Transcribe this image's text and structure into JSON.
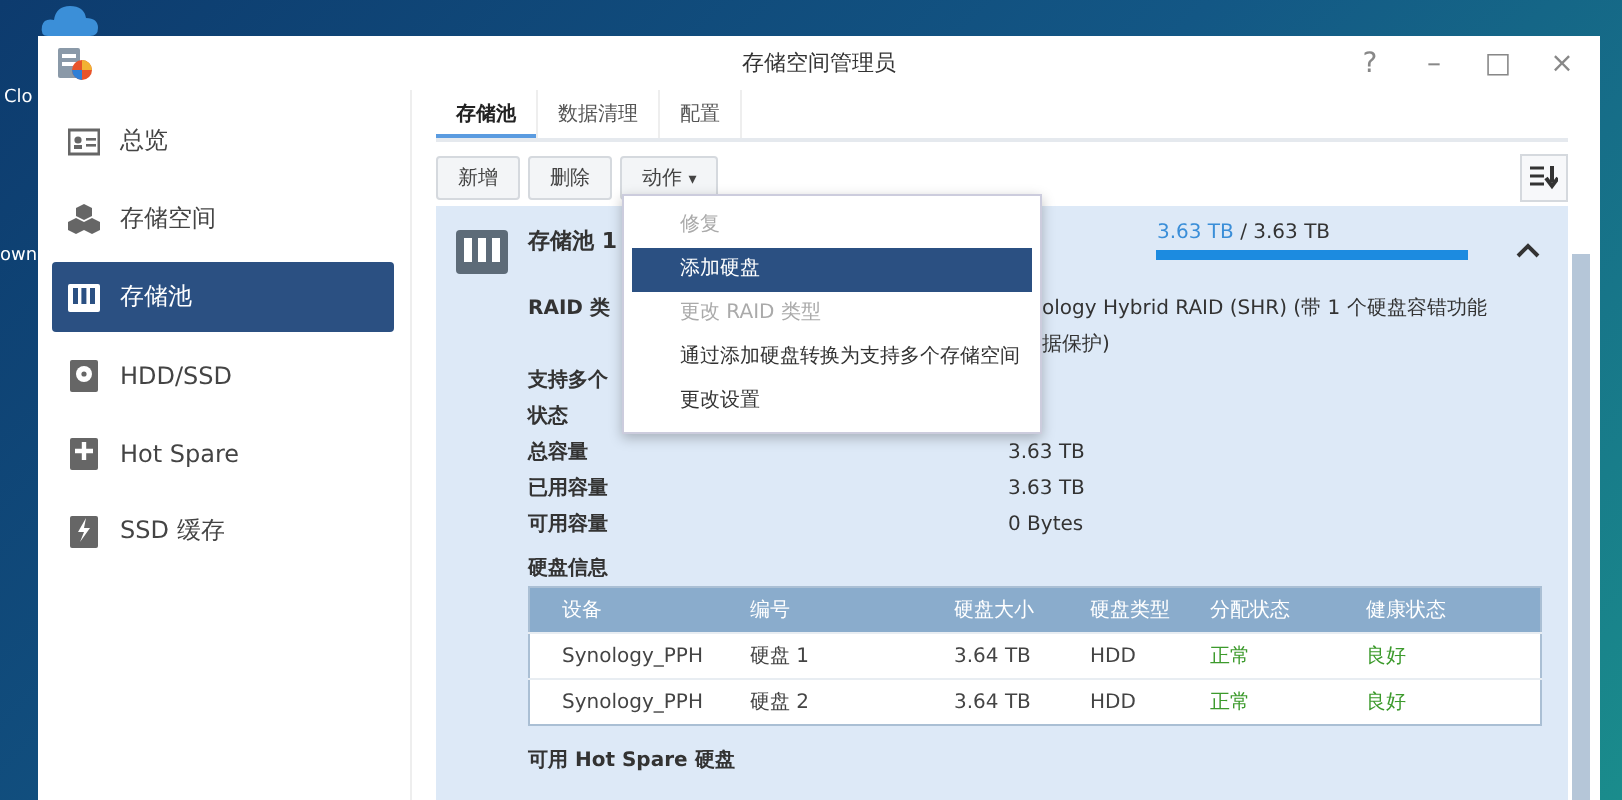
{
  "desktop": {
    "icon_labels": [
      "Clo",
      "own"
    ]
  },
  "window": {
    "title": "存储空间管理员",
    "controls": [
      "?",
      "–",
      "□",
      "×"
    ]
  },
  "sidebar": {
    "items": [
      {
        "label": "总览",
        "selected": false
      },
      {
        "label": "存储空间",
        "selected": false
      },
      {
        "label": "存储池",
        "selected": true
      },
      {
        "label": "HDD/SSD",
        "selected": false
      },
      {
        "label": "Hot Spare",
        "selected": false
      },
      {
        "label": "SSD 缓存",
        "selected": false
      }
    ]
  },
  "tabs": [
    {
      "label": "存储池",
      "selected": true
    },
    {
      "label": "数据清理",
      "selected": false
    },
    {
      "label": "配置",
      "selected": false
    }
  ],
  "toolbar": {
    "buttons": [
      {
        "label": "新增",
        "kind": "plain"
      },
      {
        "label": "删除",
        "kind": "plain"
      },
      {
        "label": "动作",
        "kind": "dropdown",
        "caret": "▾"
      }
    ]
  },
  "action_menu": {
    "items": [
      {
        "label": "修复",
        "disabled": true,
        "selected": false
      },
      {
        "label": "添加硬盘",
        "disabled": false,
        "selected": true
      },
      {
        "label": "更改 RAID 类型",
        "disabled": true,
        "selected": false
      },
      {
        "label": "通过添加硬盘转换为支持多个存储空间",
        "disabled": false,
        "selected": false
      },
      {
        "label": "更改设置",
        "disabled": false,
        "selected": false
      }
    ]
  },
  "pool": {
    "name": "存储池 1",
    "usage_used": "3.63 TB",
    "usage_sep": " / ",
    "usage_total": "3.63 TB",
    "level": 1.0,
    "expanded": true,
    "details": [
      {
        "label": "RAID 类",
        "value": "ology Hybrid RAID (SHR) (带 1 个硬盘容错功能"
      },
      {
        "value": "据保护)"
      },
      {
        "label": "支持多个"
      },
      {
        "label": "状态"
      },
      {
        "label": "总容量",
        "value": "3.63 TB"
      },
      {
        "label": "已用容量",
        "value": "3.63 TB"
      },
      {
        "label": "可用容量",
        "value": "0 Bytes"
      }
    ],
    "disk_info_title": "硬盘信息",
    "table": {
      "columns": [
        "设备",
        "编号",
        "硬盘大小",
        "硬盘类型",
        "分配状态",
        "健康状态"
      ],
      "rows": [
        [
          "Synology_PPH",
          "硬盘 1",
          "3.64 TB",
          "HDD",
          "正常",
          "良好"
        ],
        [
          "Synology_PPH",
          "硬盘 2",
          "3.64 TB",
          "HDD",
          "正常",
          "良好"
        ]
      ]
    },
    "hot_spare_title": "可用 Hot Spare 硬盘"
  }
}
